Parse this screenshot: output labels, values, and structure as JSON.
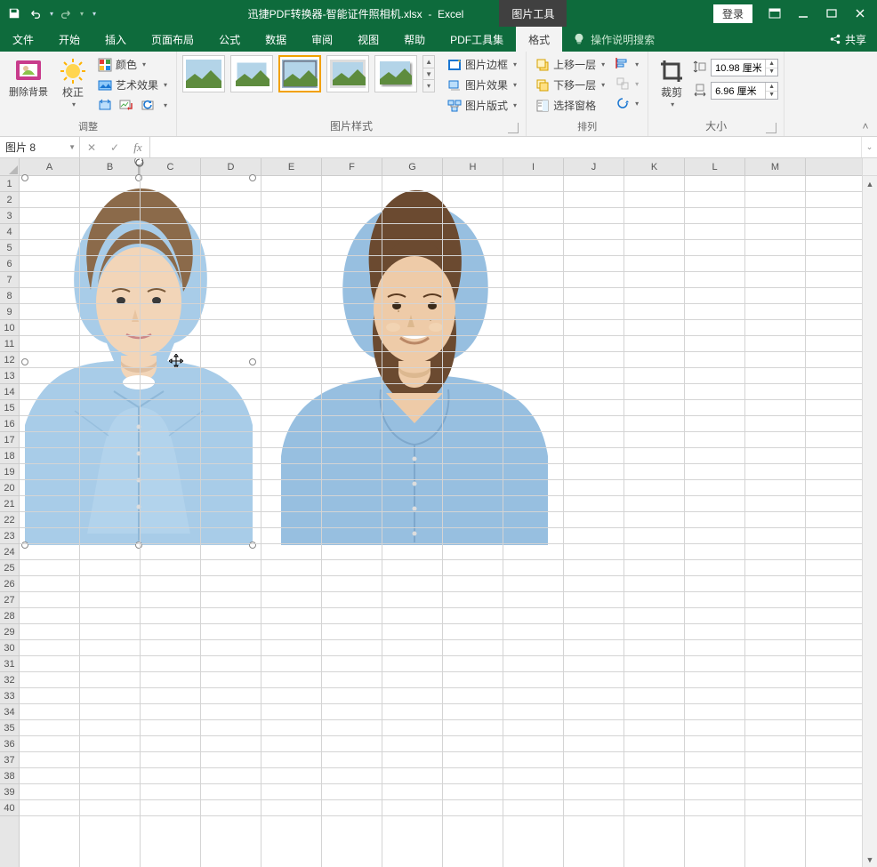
{
  "title": {
    "filename": "迅捷PDF转换器-智能证件照相机.xlsx",
    "app": "Excel",
    "context_tab": "图片工具"
  },
  "window": {
    "login": "登录"
  },
  "tabs": {
    "file": "文件",
    "home": "开始",
    "insert": "插入",
    "page_layout": "页面布局",
    "formulas": "公式",
    "data": "数据",
    "review": "审阅",
    "view": "视图",
    "help": "帮助",
    "pdf": "PDF工具集",
    "format": "格式",
    "tell_me": "操作说明搜索",
    "share": "共享"
  },
  "ribbon": {
    "adjust": {
      "label": "调整",
      "remove_bg": "删除背景",
      "corrections": "校正",
      "color": "颜色",
      "artistic": "艺术效果"
    },
    "styles": {
      "label": "图片样式",
      "border": "图片边框",
      "effects": "图片效果",
      "layout": "图片版式"
    },
    "arrange": {
      "label": "排列",
      "bring_fwd": "上移一层",
      "send_back": "下移一层",
      "selection_pane": "选择窗格"
    },
    "size": {
      "label": "大小",
      "crop": "裁剪",
      "height": "10.98 厘米",
      "width": "6.96 厘米"
    }
  },
  "namebox": {
    "value": "图片 8"
  },
  "columns": [
    "A",
    "B",
    "C",
    "D",
    "E",
    "F",
    "G",
    "H",
    "I",
    "J",
    "K",
    "L",
    "M"
  ],
  "rows_count": 40
}
